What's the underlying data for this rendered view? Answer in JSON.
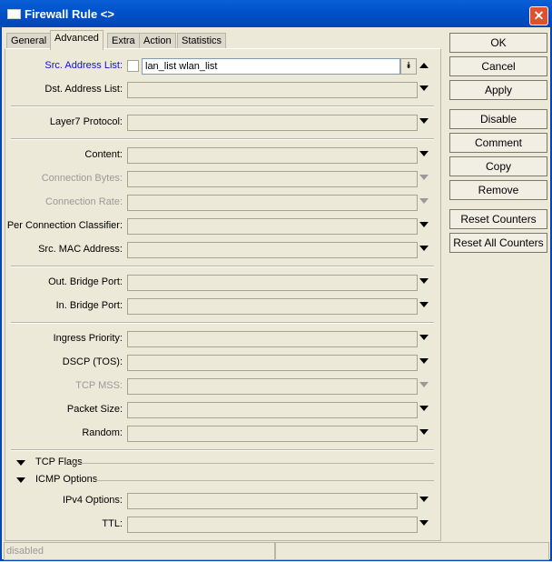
{
  "window": {
    "title": "Firewall Rule <>"
  },
  "tabs": [
    "General",
    "Advanced",
    "Extra",
    "Action",
    "Statistics"
  ],
  "active_tab": "Advanced",
  "src_address_list": {
    "label": "Src. Address List:",
    "value": "lan_list wlan_list",
    "negate_checked": false
  },
  "rows": [
    {
      "label": "Dst. Address List:",
      "enabled": true
    },
    {
      "label": "Layer7 Protocol:",
      "enabled": true
    },
    {
      "label": "Content:",
      "enabled": true
    },
    {
      "label": "Connection Bytes:",
      "enabled": false
    },
    {
      "label": "Connection Rate:",
      "enabled": false
    },
    {
      "label": "Per Connection Classifier:",
      "enabled": true
    },
    {
      "label": "Src. MAC Address:",
      "enabled": true
    },
    {
      "label": "Out. Bridge Port:",
      "enabled": true
    },
    {
      "label": "In. Bridge Port:",
      "enabled": true
    },
    {
      "label": "Ingress Priority:",
      "enabled": true
    },
    {
      "label": "DSCP (TOS):",
      "enabled": true
    },
    {
      "label": "TCP MSS:",
      "enabled": false
    },
    {
      "label": "Packet Size:",
      "enabled": true
    },
    {
      "label": "Random:",
      "enabled": true
    },
    {
      "label": "IPv4 Options:",
      "enabled": true
    },
    {
      "label": "TTL:",
      "enabled": true
    }
  ],
  "sections": [
    "TCP Flags",
    "ICMP Options"
  ],
  "buttons": [
    "OK",
    "Cancel",
    "Apply",
    "Disable",
    "Comment",
    "Copy",
    "Remove",
    "Reset Counters",
    "Reset All Counters"
  ],
  "status": {
    "left": "disabled",
    "right": ""
  }
}
